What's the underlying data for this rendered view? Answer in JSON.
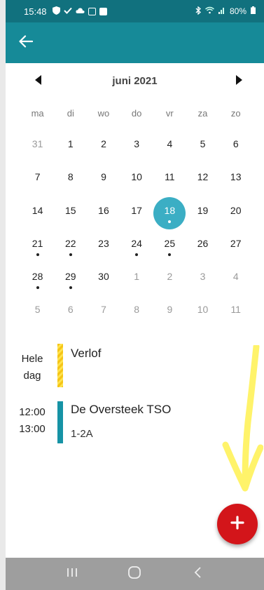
{
  "status_bar": {
    "time": "15:48",
    "battery": "80%"
  },
  "calendar": {
    "month_title": "juni 2021",
    "weekdays": [
      "ma",
      "di",
      "wo",
      "do",
      "vr",
      "za",
      "zo"
    ],
    "days": [
      {
        "n": "31",
        "muted": true,
        "dot": false
      },
      {
        "n": "1",
        "muted": false,
        "dot": false
      },
      {
        "n": "2",
        "muted": false,
        "dot": false
      },
      {
        "n": "3",
        "muted": false,
        "dot": false
      },
      {
        "n": "4",
        "muted": false,
        "dot": false
      },
      {
        "n": "5",
        "muted": false,
        "dot": false
      },
      {
        "n": "6",
        "muted": false,
        "dot": false
      },
      {
        "n": "7",
        "muted": false,
        "dot": false
      },
      {
        "n": "8",
        "muted": false,
        "dot": false
      },
      {
        "n": "9",
        "muted": false,
        "dot": false
      },
      {
        "n": "10",
        "muted": false,
        "dot": false
      },
      {
        "n": "11",
        "muted": false,
        "dot": false
      },
      {
        "n": "12",
        "muted": false,
        "dot": false
      },
      {
        "n": "13",
        "muted": false,
        "dot": false
      },
      {
        "n": "14",
        "muted": false,
        "dot": false
      },
      {
        "n": "15",
        "muted": false,
        "dot": false
      },
      {
        "n": "16",
        "muted": false,
        "dot": false
      },
      {
        "n": "17",
        "muted": false,
        "dot": false
      },
      {
        "n": "18",
        "muted": false,
        "dot": true,
        "selected": true
      },
      {
        "n": "19",
        "muted": false,
        "dot": false
      },
      {
        "n": "20",
        "muted": false,
        "dot": false
      },
      {
        "n": "21",
        "muted": false,
        "dot": true
      },
      {
        "n": "22",
        "muted": false,
        "dot": true
      },
      {
        "n": "23",
        "muted": false,
        "dot": false
      },
      {
        "n": "24",
        "muted": false,
        "dot": true
      },
      {
        "n": "25",
        "muted": false,
        "dot": true
      },
      {
        "n": "26",
        "muted": false,
        "dot": false
      },
      {
        "n": "27",
        "muted": false,
        "dot": false
      },
      {
        "n": "28",
        "muted": false,
        "dot": true
      },
      {
        "n": "29",
        "muted": false,
        "dot": true
      },
      {
        "n": "30",
        "muted": false,
        "dot": false
      },
      {
        "n": "1",
        "muted": true,
        "dot": false
      },
      {
        "n": "2",
        "muted": true,
        "dot": false
      },
      {
        "n": "3",
        "muted": true,
        "dot": false
      },
      {
        "n": "4",
        "muted": true,
        "dot": false
      },
      {
        "n": "5",
        "muted": true,
        "dot": false
      },
      {
        "n": "6",
        "muted": true,
        "dot": false
      },
      {
        "n": "7",
        "muted": true,
        "dot": false
      },
      {
        "n": "8",
        "muted": true,
        "dot": false
      },
      {
        "n": "9",
        "muted": true,
        "dot": false
      },
      {
        "n": "10",
        "muted": true,
        "dot": false
      },
      {
        "n": "11",
        "muted": true,
        "dot": false
      }
    ]
  },
  "events": [
    {
      "time_line1": "Hele",
      "time_line2": "dag",
      "title": "Verlof",
      "subtitle": "",
      "color": "yellow"
    },
    {
      "time_line1": "12:00",
      "time_line2": "13:00",
      "title": "De Oversteek TSO",
      "subtitle": "1-2A",
      "color": "teal"
    }
  ],
  "colors": {
    "status_bar": "#11717e",
    "app_bar": "#168a98",
    "selected_day": "#3baec4",
    "fab": "#d3151a",
    "event_teal": "#1693a5",
    "event_yellow": "#f5c518",
    "annotation_arrow": "#fff36a"
  },
  "icons": {
    "back": "arrow-left-icon",
    "prev": "triangle-left-icon",
    "next": "triangle-right-icon",
    "fab": "plus-icon",
    "nav_recents": "recents-icon",
    "nav_home": "home-icon",
    "nav_back": "back-chevron-icon"
  }
}
